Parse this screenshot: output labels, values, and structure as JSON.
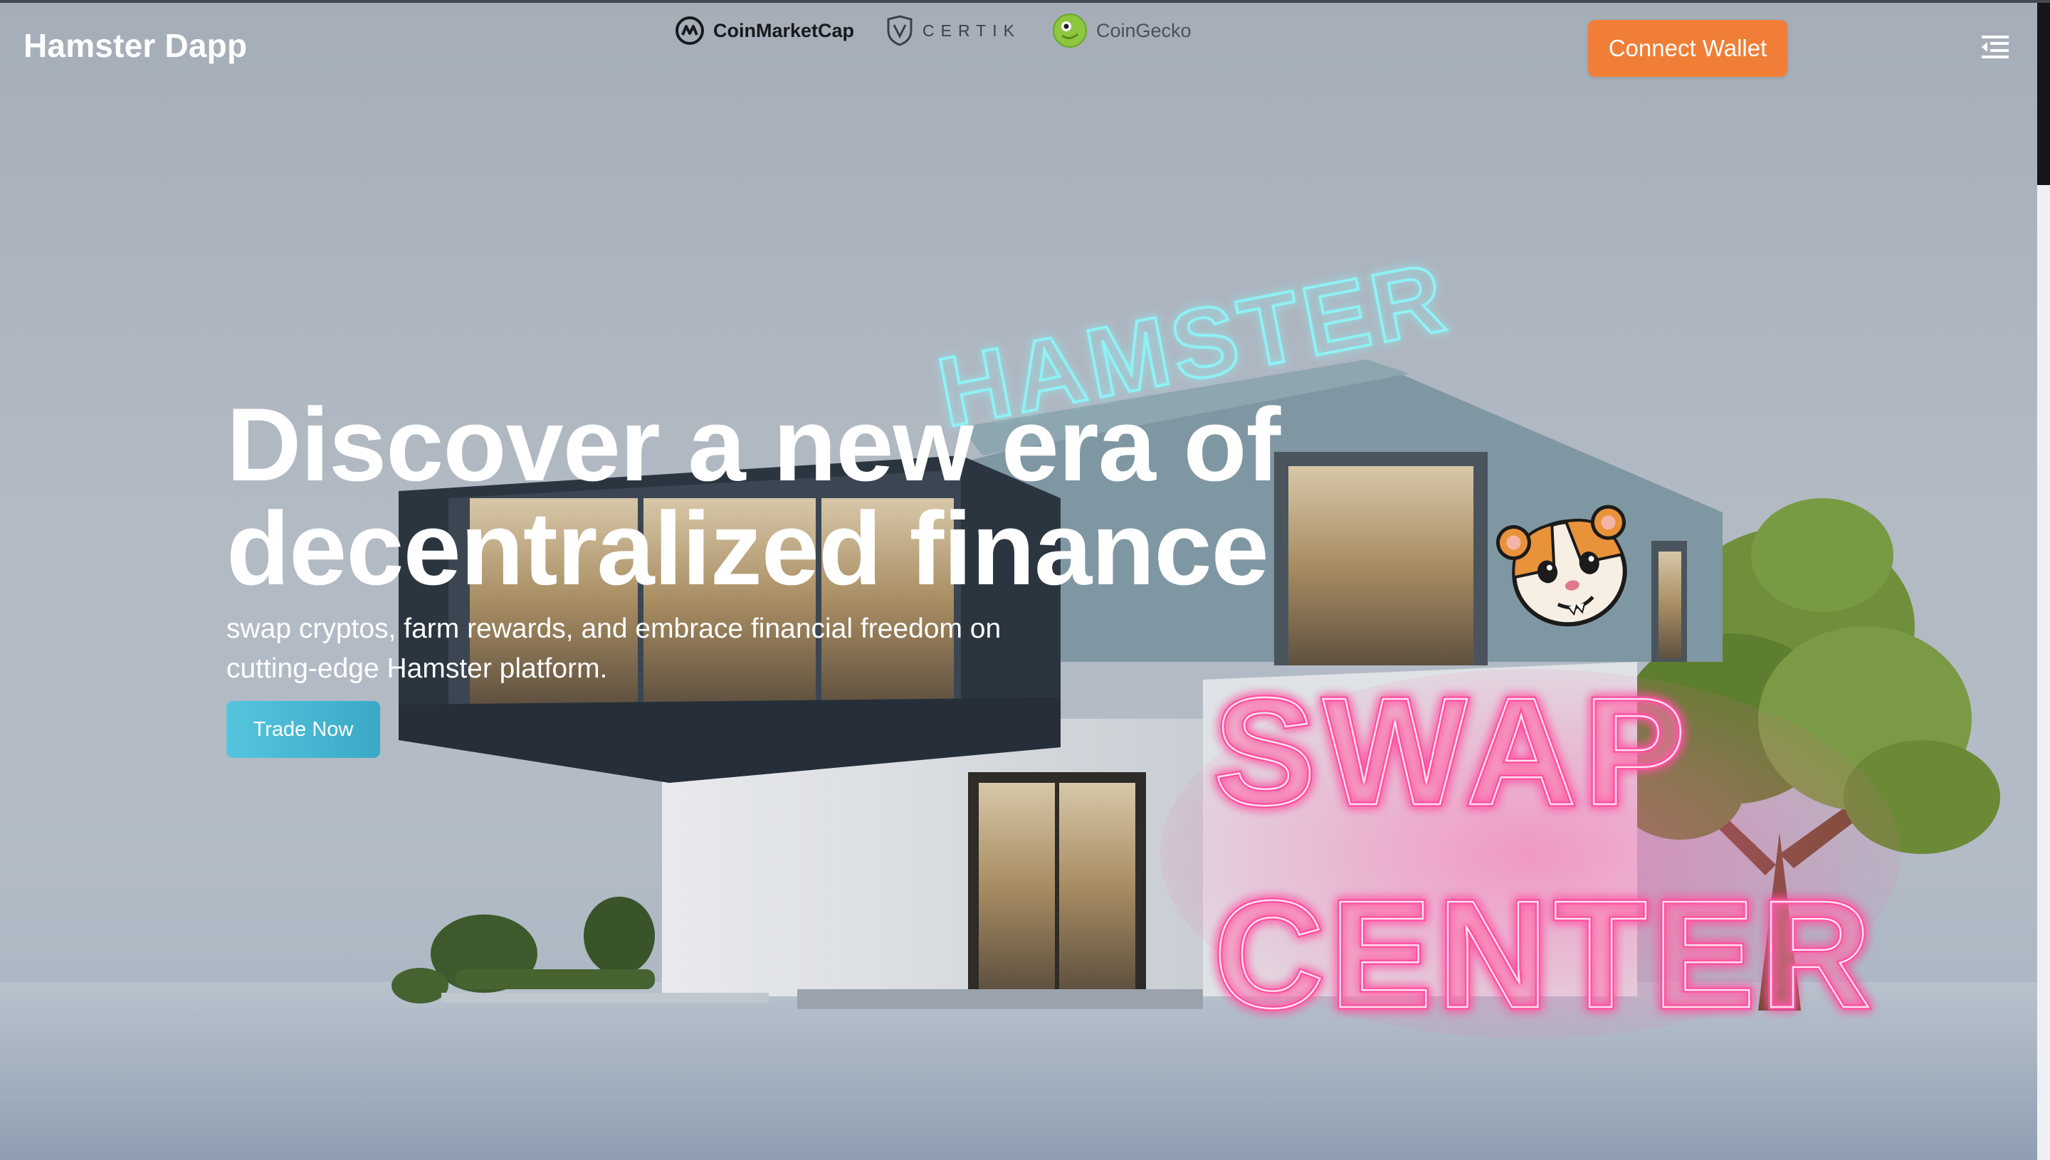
{
  "header": {
    "brand": "Hamster Dapp",
    "partners": [
      {
        "name": "CoinMarketCap",
        "icon": "coinmarketcap-logo-icon"
      },
      {
        "name": "CERTIK",
        "icon": "certik-shield-icon"
      },
      {
        "name": "CoinGecko",
        "icon": "coingecko-logo-icon"
      }
    ],
    "connect_wallet_label": "Connect Wallet",
    "menu_icon": "menu-toggle-icon"
  },
  "hero": {
    "headline_line1": "Discover a new era of",
    "headline_line2": "decentralized finance",
    "subtext": "swap cryptos, farm rewards, and embrace financial freedom on cutting-edge Hamster platform.",
    "trade_label": "Trade Now"
  },
  "neon": {
    "hamster": "HAMSTER",
    "swap": "SWAP",
    "center": "CENTER"
  },
  "colors": {
    "accent_orange": "#f07e36",
    "trade_button": "#4bb9d4",
    "neon_pink": "#ff3d96",
    "neon_cyan": "#7fe7ef"
  }
}
